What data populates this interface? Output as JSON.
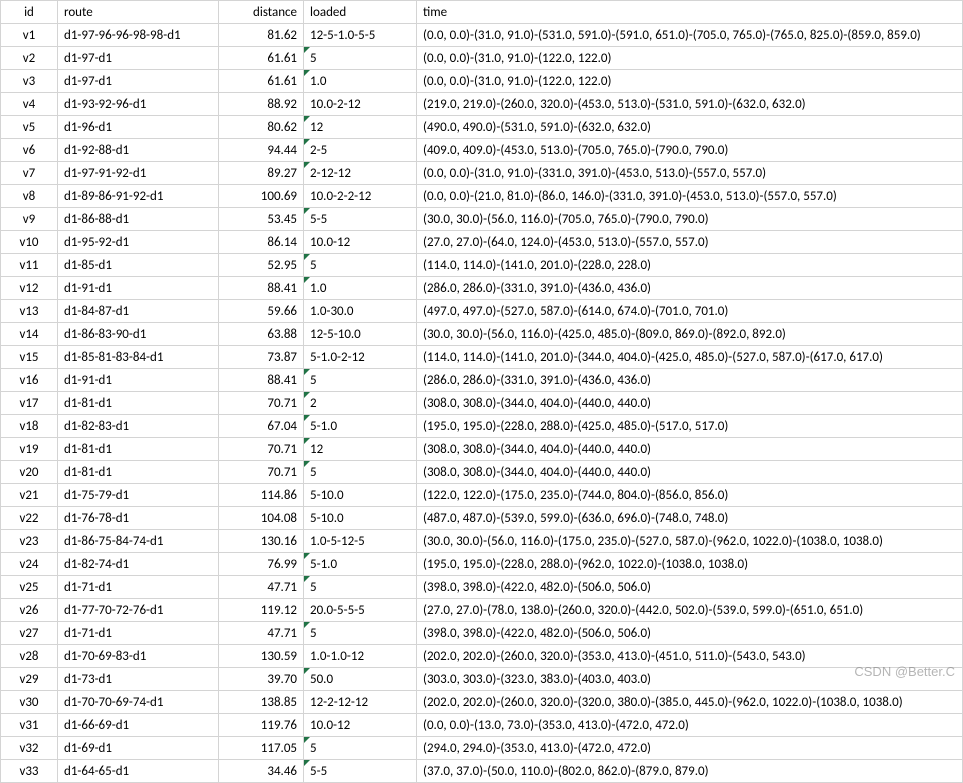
{
  "headers": {
    "id": "id",
    "route": "route",
    "distance": "distance",
    "loaded": "loaded",
    "time": "time"
  },
  "rows": [
    {
      "id": "v1",
      "route": "d1-97-96-96-98-98-d1",
      "distance": "81.62",
      "loaded": "12-5-1.0-5-5",
      "time": "(0.0, 0.0)-(31.0, 91.0)-(531.0, 591.0)-(591.0, 651.0)-(705.0, 765.0)-(765.0, 825.0)-(859.0, 859.0)",
      "tri": false
    },
    {
      "id": "v2",
      "route": "d1-97-d1",
      "distance": "61.61",
      "loaded": "5",
      "time": "(0.0, 0.0)-(31.0, 91.0)-(122.0, 122.0)",
      "tri": true
    },
    {
      "id": "v3",
      "route": "d1-97-d1",
      "distance": "61.61",
      "loaded": "1.0",
      "time": "(0.0, 0.0)-(31.0, 91.0)-(122.0, 122.0)",
      "tri": true
    },
    {
      "id": "v4",
      "route": "d1-93-92-96-d1",
      "distance": "88.92",
      "loaded": "10.0-2-12",
      "time": "(219.0, 219.0)-(260.0, 320.0)-(453.0, 513.0)-(531.0, 591.0)-(632.0, 632.0)",
      "tri": false
    },
    {
      "id": "v5",
      "route": "d1-96-d1",
      "distance": "80.62",
      "loaded": "12",
      "time": "(490.0, 490.0)-(531.0, 591.0)-(632.0, 632.0)",
      "tri": true
    },
    {
      "id": "v6",
      "route": "d1-92-88-d1",
      "distance": "94.44",
      "loaded": "2-5",
      "time": "(409.0, 409.0)-(453.0, 513.0)-(705.0, 765.0)-(790.0, 790.0)",
      "tri": true
    },
    {
      "id": "v7",
      "route": "d1-97-91-92-d1",
      "distance": "89.27",
      "loaded": "2-12-12",
      "time": "(0.0, 0.0)-(31.0, 91.0)-(331.0, 391.0)-(453.0, 513.0)-(557.0, 557.0)",
      "tri": true
    },
    {
      "id": "v8",
      "route": "d1-89-86-91-92-d1",
      "distance": "100.69",
      "loaded": "10.0-2-2-12",
      "time": "(0.0, 0.0)-(21.0, 81.0)-(86.0, 146.0)-(331.0, 391.0)-(453.0, 513.0)-(557.0, 557.0)",
      "tri": false
    },
    {
      "id": "v9",
      "route": "d1-86-88-d1",
      "distance": "53.45",
      "loaded": "5-5",
      "time": "(30.0, 30.0)-(56.0, 116.0)-(705.0, 765.0)-(790.0, 790.0)",
      "tri": true
    },
    {
      "id": "v10",
      "route": "d1-95-92-d1",
      "distance": "86.14",
      "loaded": "10.0-12",
      "time": "(27.0, 27.0)-(64.0, 124.0)-(453.0, 513.0)-(557.0, 557.0)",
      "tri": false
    },
    {
      "id": "v11",
      "route": "d1-85-d1",
      "distance": "52.95",
      "loaded": "5",
      "time": "(114.0, 114.0)-(141.0, 201.0)-(228.0, 228.0)",
      "tri": true
    },
    {
      "id": "v12",
      "route": "d1-91-d1",
      "distance": "88.41",
      "loaded": "1.0",
      "time": "(286.0, 286.0)-(331.0, 391.0)-(436.0, 436.0)",
      "tri": true
    },
    {
      "id": "v13",
      "route": "d1-84-87-d1",
      "distance": "59.66",
      "loaded": "1.0-30.0",
      "time": "(497.0, 497.0)-(527.0, 587.0)-(614.0, 674.0)-(701.0, 701.0)",
      "tri": false
    },
    {
      "id": "v14",
      "route": "d1-86-83-90-d1",
      "distance": "63.88",
      "loaded": "12-5-10.0",
      "time": "(30.0, 30.0)-(56.0, 116.0)-(425.0, 485.0)-(809.0, 869.0)-(892.0, 892.0)",
      "tri": false
    },
    {
      "id": "v15",
      "route": "d1-85-81-83-84-d1",
      "distance": "73.87",
      "loaded": "5-1.0-2-12",
      "time": "(114.0, 114.0)-(141.0, 201.0)-(344.0, 404.0)-(425.0, 485.0)-(527.0, 587.0)-(617.0, 617.0)",
      "tri": false
    },
    {
      "id": "v16",
      "route": "d1-91-d1",
      "distance": "88.41",
      "loaded": "5",
      "time": "(286.0, 286.0)-(331.0, 391.0)-(436.0, 436.0)",
      "tri": true
    },
    {
      "id": "v17",
      "route": "d1-81-d1",
      "distance": "70.71",
      "loaded": "2",
      "time": "(308.0, 308.0)-(344.0, 404.0)-(440.0, 440.0)",
      "tri": true
    },
    {
      "id": "v18",
      "route": "d1-82-83-d1",
      "distance": "67.04",
      "loaded": "5-1.0",
      "time": "(195.0, 195.0)-(228.0, 288.0)-(425.0, 485.0)-(517.0, 517.0)",
      "tri": true
    },
    {
      "id": "v19",
      "route": "d1-81-d1",
      "distance": "70.71",
      "loaded": "12",
      "time": "(308.0, 308.0)-(344.0, 404.0)-(440.0, 440.0)",
      "tri": true
    },
    {
      "id": "v20",
      "route": "d1-81-d1",
      "distance": "70.71",
      "loaded": "5",
      "time": "(308.0, 308.0)-(344.0, 404.0)-(440.0, 440.0)",
      "tri": true
    },
    {
      "id": "v21",
      "route": "d1-75-79-d1",
      "distance": "114.86",
      "loaded": "5-10.0",
      "time": "(122.0, 122.0)-(175.0, 235.0)-(744.0, 804.0)-(856.0, 856.0)",
      "tri": false
    },
    {
      "id": "v22",
      "route": "d1-76-78-d1",
      "distance": "104.08",
      "loaded": "5-10.0",
      "time": "(487.0, 487.0)-(539.0, 599.0)-(636.0, 696.0)-(748.0, 748.0)",
      "tri": false
    },
    {
      "id": "v23",
      "route": "d1-86-75-84-74-d1",
      "distance": "130.16",
      "loaded": "1.0-5-12-5",
      "time": "(30.0, 30.0)-(56.0, 116.0)-(175.0, 235.0)-(527.0, 587.0)-(962.0, 1022.0)-(1038.0, 1038.0)",
      "tri": false
    },
    {
      "id": "v24",
      "route": "d1-82-74-d1",
      "distance": "76.99",
      "loaded": "5-1.0",
      "time": "(195.0, 195.0)-(228.0, 288.0)-(962.0, 1022.0)-(1038.0, 1038.0)",
      "tri": true
    },
    {
      "id": "v25",
      "route": "d1-71-d1",
      "distance": "47.71",
      "loaded": "5",
      "time": "(398.0, 398.0)-(422.0, 482.0)-(506.0, 506.0)",
      "tri": true
    },
    {
      "id": "v26",
      "route": "d1-77-70-72-76-d1",
      "distance": "119.12",
      "loaded": "20.0-5-5-5",
      "time": "(27.0, 27.0)-(78.0, 138.0)-(260.0, 320.0)-(442.0, 502.0)-(539.0, 599.0)-(651.0, 651.0)",
      "tri": false
    },
    {
      "id": "v27",
      "route": "d1-71-d1",
      "distance": "47.71",
      "loaded": "5",
      "time": "(398.0, 398.0)-(422.0, 482.0)-(506.0, 506.0)",
      "tri": true
    },
    {
      "id": "v28",
      "route": "d1-70-69-83-d1",
      "distance": "130.59",
      "loaded": "1.0-1.0-12",
      "time": "(202.0, 202.0)-(260.0, 320.0)-(353.0, 413.0)-(451.0, 511.0)-(543.0, 543.0)",
      "tri": false
    },
    {
      "id": "v29",
      "route": "d1-73-d1",
      "distance": "39.70",
      "loaded": "50.0",
      "time": "(303.0, 303.0)-(323.0, 383.0)-(403.0, 403.0)",
      "tri": true
    },
    {
      "id": "v30",
      "route": "d1-70-70-69-74-d1",
      "distance": "138.85",
      "loaded": "12-2-12-12",
      "time": "(202.0, 202.0)-(260.0, 320.0)-(320.0, 380.0)-(385.0, 445.0)-(962.0, 1022.0)-(1038.0, 1038.0)",
      "tri": false
    },
    {
      "id": "v31",
      "route": "d1-66-69-d1",
      "distance": "119.76",
      "loaded": "10.0-12",
      "time": "(0.0, 0.0)-(13.0, 73.0)-(353.0, 413.0)-(472.0, 472.0)",
      "tri": false
    },
    {
      "id": "v32",
      "route": "d1-69-d1",
      "distance": "117.05",
      "loaded": "5",
      "time": "(294.0, 294.0)-(353.0, 413.0)-(472.0, 472.0)",
      "tri": true
    },
    {
      "id": "v33",
      "route": "d1-64-65-d1",
      "distance": "34.46",
      "loaded": "5-5",
      "time": "(37.0, 37.0)-(50.0, 110.0)-(802.0, 862.0)-(879.0, 879.0)",
      "tri": true
    }
  ],
  "watermark": "CSDN @Better.C"
}
